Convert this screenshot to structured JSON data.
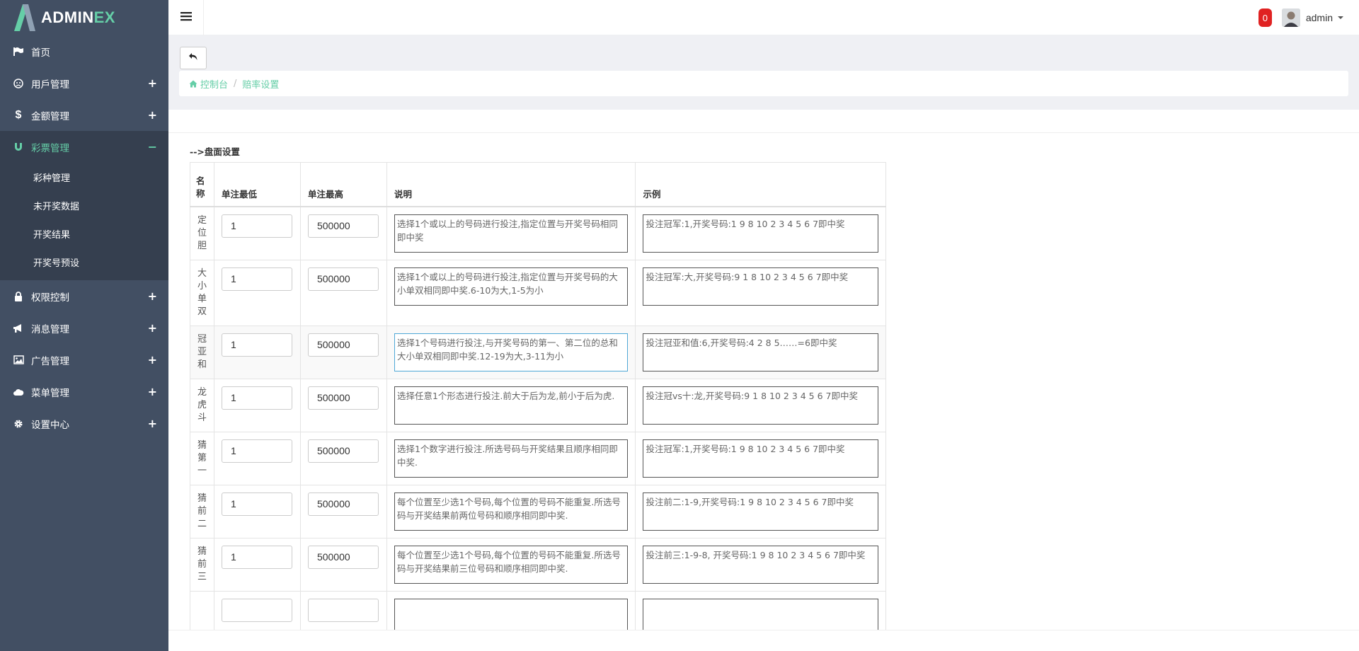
{
  "brand": {
    "part1": "ADMIN",
    "part2": "EX"
  },
  "sidebar": {
    "items": [
      {
        "label": "首页",
        "icon": "flag-icon"
      },
      {
        "label": "用戶管理",
        "icon": "user-icon",
        "expand": "+"
      },
      {
        "label": "金额管理",
        "icon": "dollar-icon",
        "expand": "+"
      },
      {
        "label": "彩票管理",
        "icon": "magnet-icon",
        "expand": "−"
      },
      {
        "label": "权限控制",
        "icon": "lock-icon",
        "expand": "+"
      },
      {
        "label": "消息管理",
        "icon": "bullhorn-icon",
        "expand": "+"
      },
      {
        "label": "广告管理",
        "icon": "image-icon",
        "expand": "+"
      },
      {
        "label": "菜单管理",
        "icon": "cloud-icon",
        "expand": "+"
      },
      {
        "label": "设置中心",
        "icon": "gear-icon",
        "expand": "+"
      }
    ],
    "subitems": [
      "彩种管理",
      "未开奖数据",
      "开奖结果",
      "开奖号预设"
    ]
  },
  "header": {
    "notification_count": "0",
    "username": "admin"
  },
  "breadcrumb": {
    "home": "控制台",
    "separator": "/",
    "current": "赔率设置"
  },
  "section_title": "-->盘面设置",
  "table": {
    "headers": {
      "name": "名称",
      "min": "单注最低",
      "max": "单注最高",
      "desc": "说明",
      "example": "示例"
    },
    "rows": [
      {
        "name": "定位胆",
        "min": "1",
        "max": "500000",
        "desc": "选择1个或以上的号码进行投注,指定位置与开奖号码相同即中奖",
        "example": "投注冠军:1,开奖号码:1 9 8 10 2 3 4 5 6 7即中奖"
      },
      {
        "name": "大小单双",
        "min": "1",
        "max": "500000",
        "desc": "选择1个或以上的号码进行投注,指定位置与开奖号码的大小单双相同即中奖.6-10为大,1-5为小",
        "example": "投注冠军:大,开奖号码:9 1 8 10 2 3 4 5 6 7即中奖"
      },
      {
        "name": "冠亚和",
        "min": "1",
        "max": "500000",
        "desc": "选择1个号码进行投注,与开奖号码的第一、第二位的总和大小单双相同即中奖.12-19为大,3-11为小",
        "example": "投注冠亚和值:6,开奖号码:4 2 8 5……=6即中奖"
      },
      {
        "name": "龙虎斗",
        "min": "1",
        "max": "500000",
        "desc": "选择任意1个形态进行投注.前大于后为龙,前小于后为虎.",
        "example": "投注冠vs十:龙,开奖号码:9 1 8 10 2 3 4 5 6 7即中奖"
      },
      {
        "name": "猜第一",
        "min": "1",
        "max": "500000",
        "desc": "选择1个数字进行投注.所选号码与开奖结果且顺序相同即中奖.",
        "example": "投注冠军:1,开奖号码:1 9 8 10 2 3 4 5 6 7即中奖"
      },
      {
        "name": "猜前二",
        "min": "1",
        "max": "500000",
        "desc": "每个位置至少选1个号码,每个位置的号码不能重复.所选号码与开奖结果前两位号码和顺序相同即中奖.",
        "example": "投注前二:1-9,开奖号码:1 9 8 10 2 3 4 5 6 7即中奖"
      },
      {
        "name": "猜前三",
        "min": "1",
        "max": "500000",
        "desc": "每个位置至少选1个号码,每个位置的号码不能重复.所选号码与开奖结果前三位号码和顺序相同即中奖.",
        "example": "投注前三:1-9-8, 开奖号码:1 9 8 10 2 3 4 5 6 7即中奖"
      },
      {
        "name": "",
        "min": "",
        "max": "",
        "desc": "",
        "example": ""
      }
    ]
  },
  "colors": {
    "sidebar_bg": "#424f63",
    "accent": "#65cea7",
    "badge": "#e02222"
  }
}
